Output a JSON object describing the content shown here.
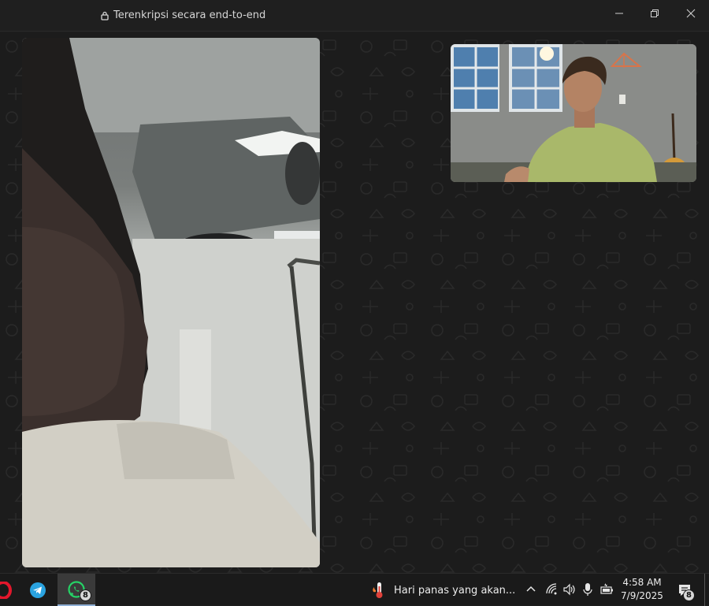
{
  "window": {
    "title": "Terenkripsi secara end-to-end",
    "controls": [
      "minimize-icon",
      "restore-icon",
      "close-icon"
    ]
  },
  "call": {
    "main_video": "remote-participant-video",
    "pip_video": "self-view-video"
  },
  "taskbar": {
    "apps": [
      {
        "name": "opera",
        "icon": "opera-icon"
      },
      {
        "name": "telegram",
        "icon": "telegram-icon"
      },
      {
        "name": "whatsapp",
        "icon": "whatsapp-icon",
        "badge": "8",
        "active": true
      }
    ],
    "weather": {
      "icon": "thermometer-icon",
      "text": "Hari panas yang akan..."
    },
    "tray": [
      "chevron-up-icon",
      "network-icon",
      "volume-icon",
      "microphone-icon",
      "battery-icon"
    ],
    "clock": {
      "time": "4:58 AM",
      "date": "7/9/2025"
    },
    "notifications": {
      "icon": "notification-icon",
      "badge": "8"
    }
  },
  "colors": {
    "background": "#1c1c1c",
    "titlebar": "#1f1f1f",
    "taskbar": "#1a1a1a",
    "whatsapp_green": "#25d366",
    "telegram_blue": "#2aa3e0",
    "opera_red": "#e3172c"
  }
}
